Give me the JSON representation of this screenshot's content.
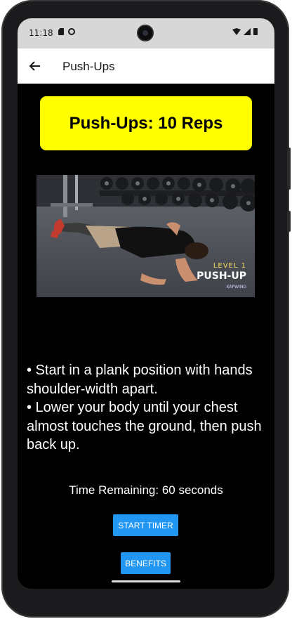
{
  "status_bar": {
    "time": "11:18",
    "icons": [
      "sim-card-icon",
      "app-notification-icon",
      "wifi-icon",
      "signal-icon",
      "battery-icon"
    ]
  },
  "app_bar": {
    "back_icon": "arrow-left",
    "title": "Push-Ups"
  },
  "title_card": {
    "text": "Push-Ups: 10 Reps",
    "background": "#ffff00"
  },
  "exercise_image": {
    "overlay_level": "LEVEL 1",
    "overlay_title": "PUSH-UP",
    "overlay_watermark": "KAPWING"
  },
  "instructions": [
    "• Start in a plank position with hands shoulder-width apart.",
    "• Lower your body until your chest almost touches the ground, then push back up."
  ],
  "timer": {
    "text": "Time Remaining: 60 seconds"
  },
  "buttons": {
    "start_timer": "START TIMER",
    "benefits": "BENEFITS",
    "color": "#2196f3"
  }
}
